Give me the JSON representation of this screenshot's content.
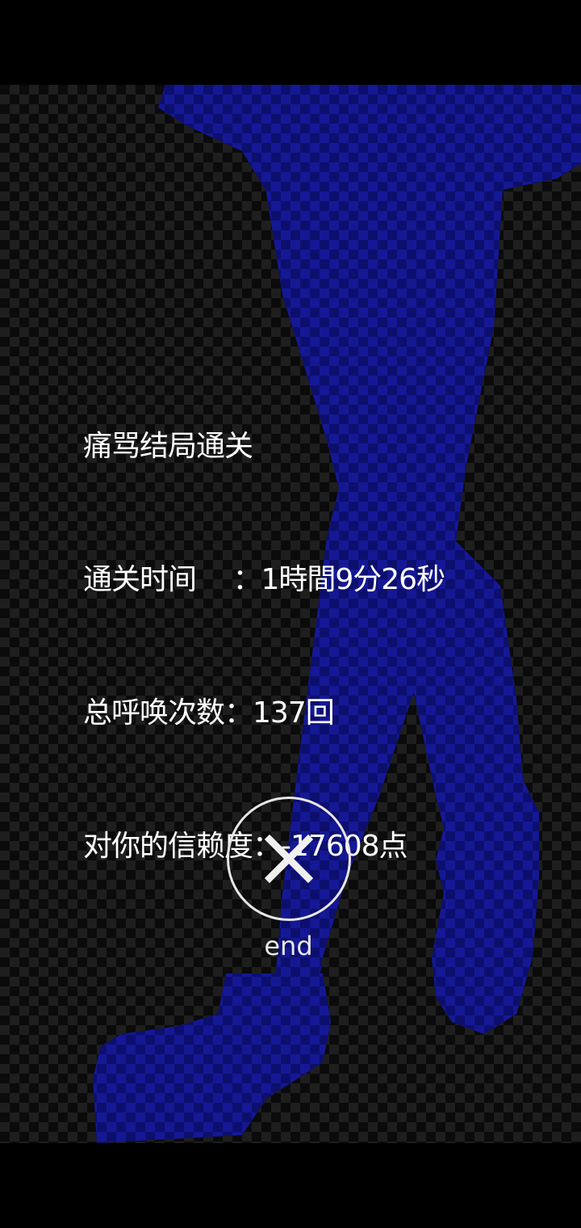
{
  "result": {
    "title": "痛骂结局通关",
    "clear_time_label": "通关时间　 ：",
    "clear_time_value": "1時間9分26秒",
    "call_count_label": "总呼唤次数：",
    "call_count_value": "137回",
    "trust_label": "对你的信赖度：",
    "trust_value": "-17608点"
  },
  "end_button": {
    "icon": "close-icon",
    "label": "end"
  },
  "colors": {
    "silhouette": "#0d0f6e",
    "text": "#ffffff",
    "background": "#000000"
  }
}
